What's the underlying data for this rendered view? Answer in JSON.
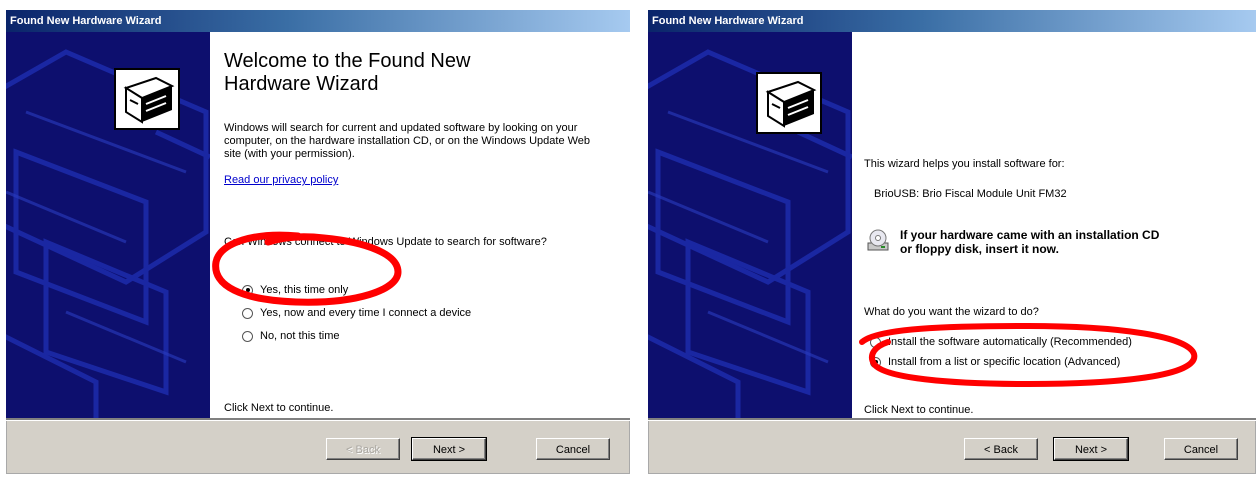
{
  "left_window": {
    "title": "Found New Hardware Wizard",
    "heading": "Welcome to the Found New Hardware Wizard",
    "intro": "Windows will search for current and updated software by looking on your computer, on the hardware installation CD, or on the Windows Update Web site (with your permission).",
    "privacy_link": "Read our privacy policy",
    "question": "Can Windows connect to Windows Update to search for software?",
    "options": [
      {
        "label": "Yes, this time only",
        "selected": true
      },
      {
        "label": "Yes, now and every time I connect a device",
        "selected": false
      },
      {
        "label": "No, not this time",
        "selected": false
      }
    ],
    "footer_text": "Click Next to continue.",
    "buttons": {
      "back": "< Back",
      "next": "Next >",
      "cancel": "Cancel"
    }
  },
  "right_window": {
    "title": "Found New Hardware Wizard",
    "intro": "This wizard helps you install software for:",
    "device_name": "BrioUSB: Brio Fiscal Module Unit FM32",
    "cd_notice_line1": "If your hardware came with an installation CD",
    "cd_notice_line2": "or floppy disk, insert it now.",
    "question": "What do you want the wizard to do?",
    "options": [
      {
        "label": "Install the software automatically (Recommended)",
        "selected": false
      },
      {
        "label": "Install from a list or specific location (Advanced)",
        "selected": true
      }
    ],
    "footer_text": "Click Next to continue.",
    "buttons": {
      "back": "< Back",
      "next": "Next >",
      "cancel": "Cancel"
    }
  },
  "colors": {
    "title_bar": "#0a246a",
    "side_panel": "#0d0f6e",
    "annotation": "#ff0000",
    "dialog_face": "#d4d0c8"
  },
  "icons": [
    "hardware-wizard-icon",
    "cd-drive-icon"
  ]
}
